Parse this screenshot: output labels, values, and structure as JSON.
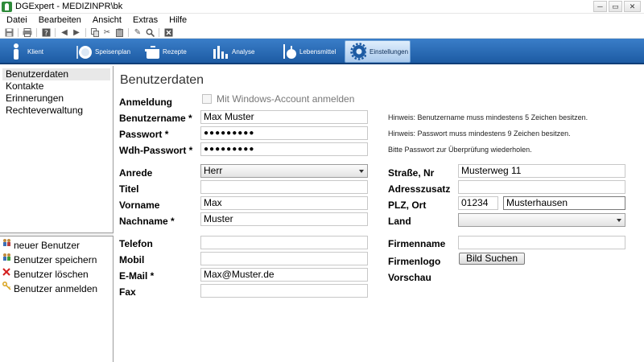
{
  "window": {
    "title": "DGExpert - MEDIZINPR\\bk",
    "buttons": [
      "─",
      "▭",
      "✕"
    ]
  },
  "menu": [
    "Datei",
    "Bearbeiten",
    "Ansicht",
    "Extras",
    "Hilfe"
  ],
  "nav_tabs": [
    {
      "label": "Klient",
      "icon": "person-icon"
    },
    {
      "label": "Speisenplan",
      "icon": "plate-icon"
    },
    {
      "label": "Rezepte",
      "icon": "pot-icon"
    },
    {
      "label": "Analyse",
      "icon": "bar-chart-icon"
    },
    {
      "label": "Lebensmittel",
      "icon": "food-icon"
    },
    {
      "label": "Einstellungen",
      "icon": "gear-icon"
    }
  ],
  "sidebar": {
    "items": [
      "Benutzerdaten",
      "Kontakte",
      "Erinnerungen",
      "Rechteverwaltung"
    ],
    "actions": [
      {
        "label": "neuer Benutzer",
        "icon": "users-icon"
      },
      {
        "label": "Benutzer speichern",
        "icon": "save-users-icon"
      },
      {
        "label": "Benutzer löschen",
        "icon": "delete-x-icon"
      },
      {
        "label": "Benutzer anmelden",
        "icon": "key-icon"
      }
    ]
  },
  "form": {
    "title": "Benutzerdaten",
    "anmeldung_label": "Anmeldung",
    "windows_account_label": "Mit Windows-Account anmelden",
    "benutzername_label": "Benutzername *",
    "benutzername_value": "Max Muster",
    "benutzername_hint": "Hinweis: Benutzername muss mindestens 5 Zeichen besitzen.",
    "passwort_label": "Passwort *",
    "passwort_value": "●●●●●●●●●",
    "passwort_hint": "Hinweis: Passwort muss mindestens 9 Zeichen besitzen.",
    "wdh_label": "Wdh-Passwort *",
    "wdh_value": "●●●●●●●●●",
    "wdh_hint": "Bitte Passwort zur Überprüfung wiederholen.",
    "anrede_label": "Anrede",
    "anrede_value": "Herr",
    "titel_label": "Titel",
    "titel_value": "",
    "vorname_label": "Vorname",
    "vorname_value": "Max",
    "nachname_label": "Nachname *",
    "nachname_value": "Muster",
    "telefon_label": "Telefon",
    "telefon_value": "",
    "mobil_label": "Mobil",
    "mobil_value": "",
    "email_label": "E-Mail *",
    "email_value": "Max@Muster.de",
    "fax_label": "Fax",
    "fax_value": "",
    "strasse_label": "Straße, Nr",
    "strasse_value": "Musterweg 11",
    "adresszusatz_label": "Adresszusatz",
    "adresszusatz_value": "",
    "plz_label": "PLZ, Ort",
    "plz_value": "01234",
    "ort_value": "Musterhausen",
    "land_label": "Land",
    "land_value": "",
    "firmenname_label": "Firmenname",
    "firmenname_value": "",
    "firmenlogo_label": "Firmenlogo",
    "bild_button": "Bild Suchen",
    "vorschau_label": "Vorschau"
  }
}
